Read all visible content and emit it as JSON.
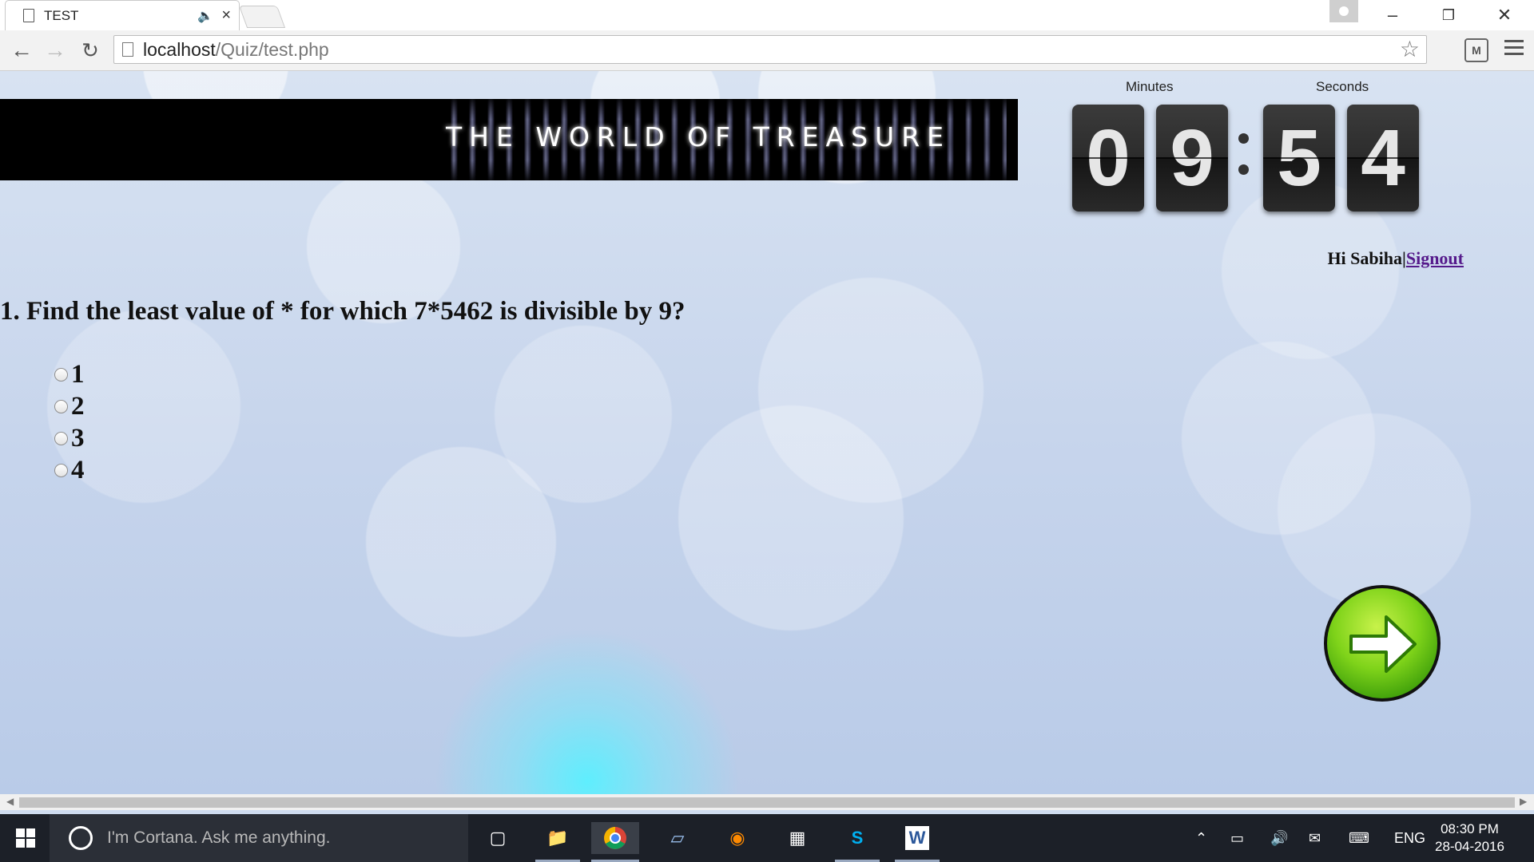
{
  "browser": {
    "tab_title": "TEST",
    "url_host": "localhost",
    "url_path": "/Quiz/test.php"
  },
  "banner": {
    "title": "THE WORLD OF TREASURE"
  },
  "timer": {
    "minutes_label": "Minutes",
    "seconds_label": "Seconds",
    "digits": [
      "0",
      "9",
      "5",
      "4"
    ]
  },
  "user": {
    "greeting": "Hi Sabiha",
    "separator": "|",
    "signout_label": "Signout"
  },
  "quiz": {
    "question": "1. Find the least value of * for which 7*5462 is divisible by 9?",
    "options": [
      "1",
      "2",
      "3",
      "4"
    ]
  },
  "taskbar": {
    "search_placeholder": "I'm Cortana. Ask me anything.",
    "language": "ENG",
    "time": "08:30 PM",
    "date": "28-04-2016"
  },
  "colors": {
    "next_button": "#7fd31a",
    "link": "#551a8b",
    "banner_bg": "#000000"
  }
}
